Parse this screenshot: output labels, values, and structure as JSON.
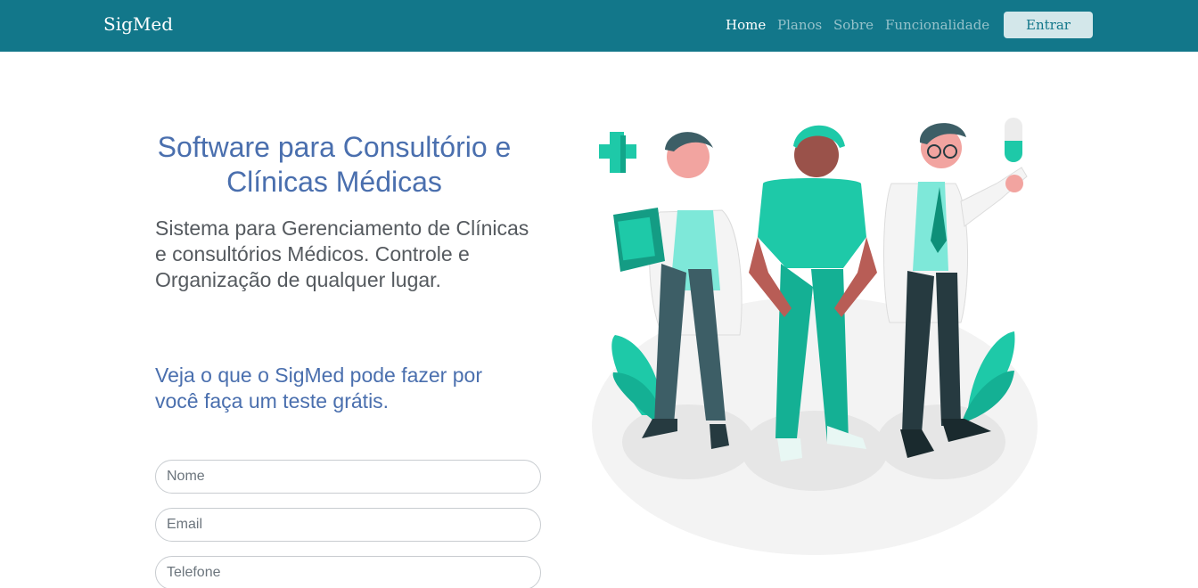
{
  "navbar": {
    "brand": "SigMed",
    "links": [
      {
        "label": "Home",
        "active": true
      },
      {
        "label": "Planos",
        "active": false
      },
      {
        "label": "Sobre",
        "active": false
      },
      {
        "label": "Funcionalidade",
        "active": false
      }
    ],
    "login_label": "Entrar",
    "background_color": "#12778a"
  },
  "hero": {
    "title": "Software para Consultório e Clínicas Médicas",
    "description": "Sistema para Gerenciamento de Clínicas e consultórios Médicos. Controle e Organização de qualquer lugar.",
    "cta": "Veja o que o SigMed pode fazer por você faça um teste grátis."
  },
  "form": {
    "name_placeholder": "Nome",
    "email_placeholder": "Email",
    "phone_placeholder": "Telefone"
  },
  "illustration": {
    "icon": "medical-team-illustration",
    "accent_color": "#1ec9a8"
  }
}
